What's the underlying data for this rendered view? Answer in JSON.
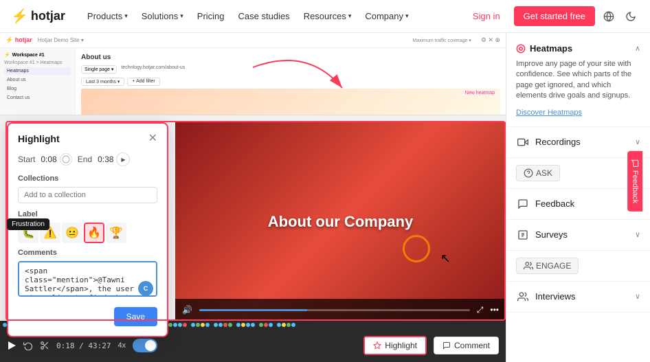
{
  "navbar": {
    "logo": "hotjar",
    "products_label": "Products",
    "solutions_label": "Solutions",
    "pricing_label": "Pricing",
    "case_studies_label": "Case studies",
    "resources_label": "Resources",
    "company_label": "Company",
    "signin_label": "Sign in",
    "get_started_label": "Get started free"
  },
  "highlight_modal": {
    "title": "Highlight",
    "start_label": "Start",
    "start_value": "0:08",
    "end_label": "End",
    "end_value": "0:38",
    "collections_label": "Collections",
    "collection_placeholder": "Add to a collection",
    "label_section": "Label",
    "frustration_tooltip": "Frustration",
    "emojis": [
      "🐛",
      "⚠️",
      "😐",
      "🔥",
      "🏆"
    ],
    "comments_label": "Comments",
    "comment_text": "@Tawni Sattler, the user is struggling to find what they're looking for",
    "mention": "@Tawni Sattler",
    "save_label": "Save"
  },
  "video_player": {
    "overlay_text": "About our Company",
    "time_display": "0:18 / 43:27",
    "speed": "4x"
  },
  "right_sidebar": {
    "heatmaps": {
      "label": "Heatmaps",
      "description": "Improve any page of your site with confidence. See which parts of the page get ignored, and which elements drive goals and signups.",
      "link": "Discover Heatmaps"
    },
    "recordings": {
      "label": "Recordings"
    },
    "ask": {
      "label": "ASK"
    },
    "feedback": {
      "label": "Feedback"
    },
    "surveys": {
      "label": "Surveys"
    },
    "engage": {
      "label": "ENGAGE"
    },
    "interviews": {
      "label": "Interviews"
    }
  },
  "timeline": {
    "time": "0:18 / 43:27",
    "speed": "4x",
    "highlight_label": "Highlight",
    "comment_label": "Comment"
  },
  "feedback_tab": {
    "label": "Feedback"
  }
}
